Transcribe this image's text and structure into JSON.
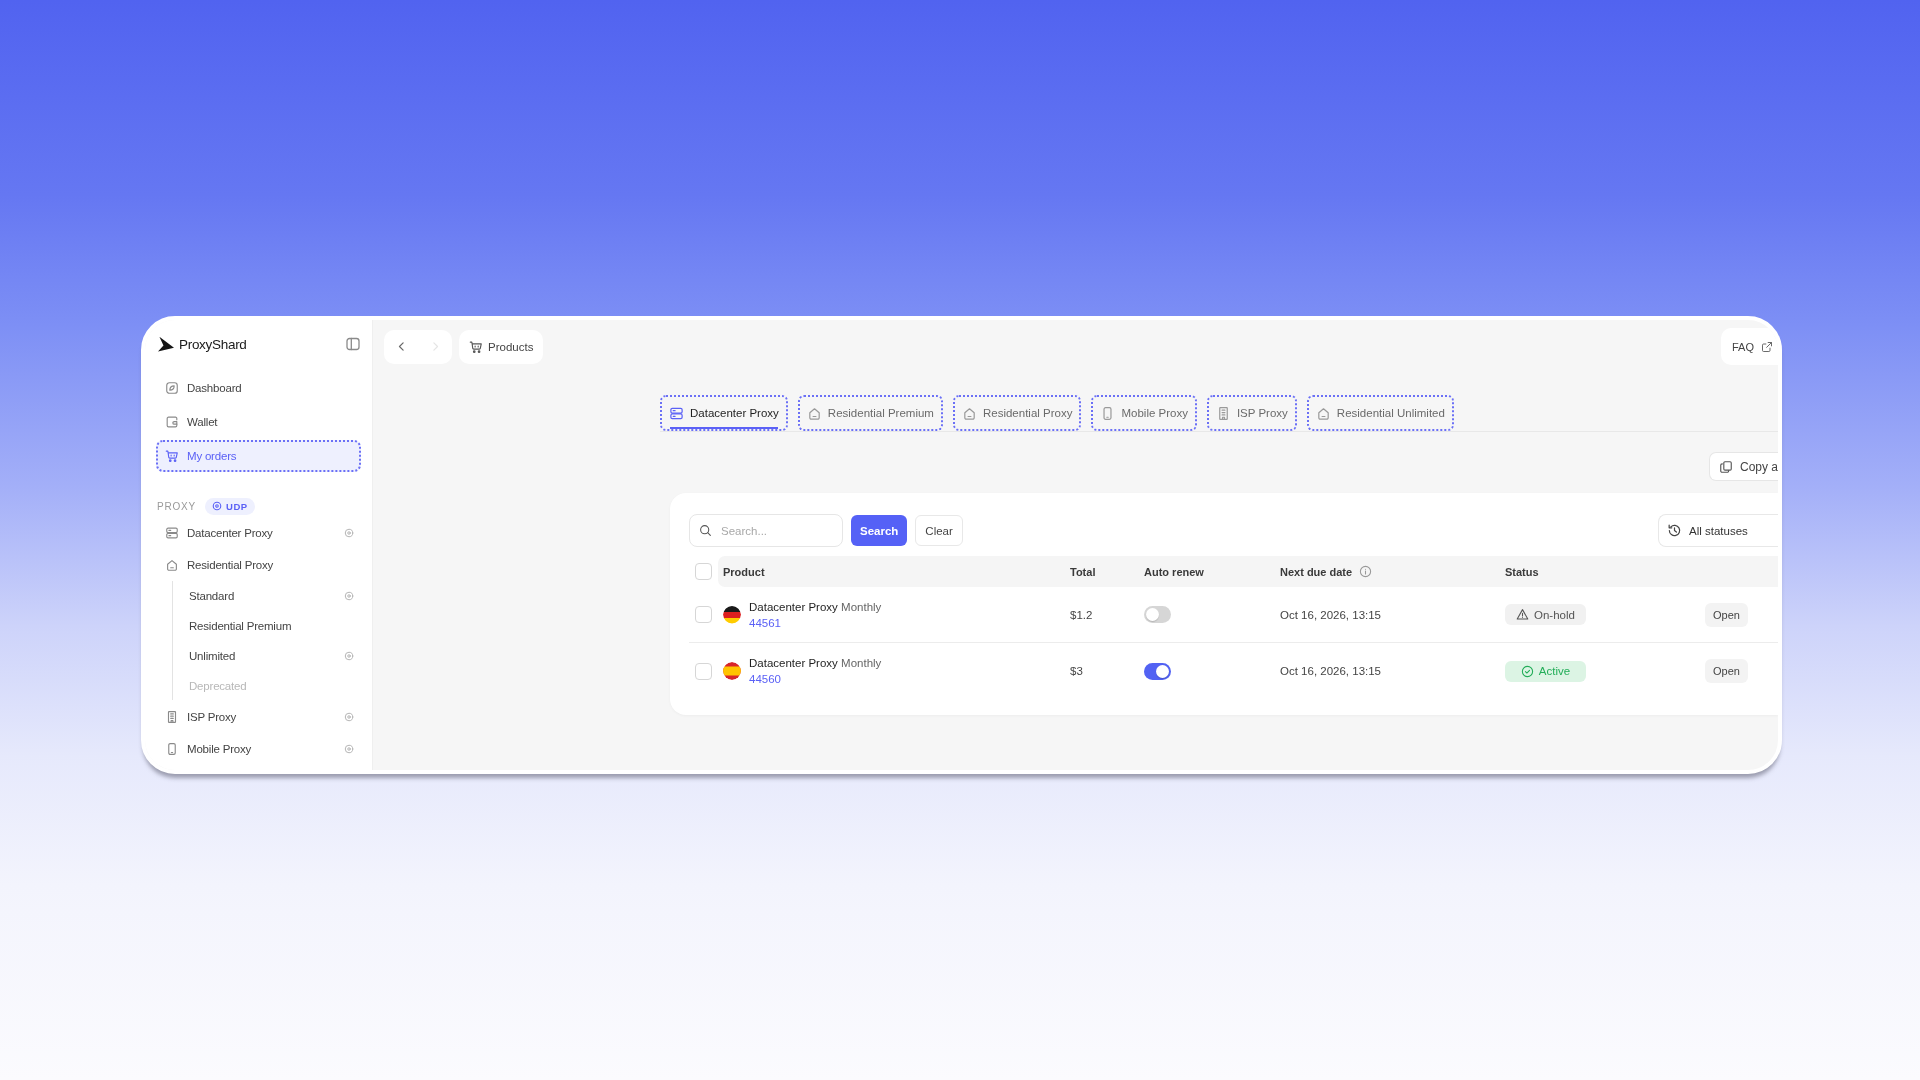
{
  "sidebar": {
    "brand": "ProxyShard",
    "nav": [
      {
        "label": "Dashboard",
        "selected": false
      },
      {
        "label": "Wallet",
        "selected": false
      },
      {
        "label": "My orders",
        "selected": true
      }
    ],
    "section_label": "PROXY",
    "section_badge": "UDP",
    "products": [
      {
        "label": "Datacenter Proxy",
        "kind": "datacenter",
        "udp": true
      },
      {
        "label": "Residential Proxy",
        "kind": "residential",
        "udp": false,
        "children": [
          {
            "label": "Standard",
            "udp": true,
            "disabled": false
          },
          {
            "label": "Residential Premium",
            "udp": false,
            "disabled": false
          },
          {
            "label": "Unlimited",
            "udp": true,
            "disabled": false
          },
          {
            "label": "Deprecated",
            "udp": false,
            "disabled": true
          }
        ]
      },
      {
        "label": "ISP Proxy",
        "kind": "isp",
        "udp": true
      },
      {
        "label": "Mobile Proxy",
        "kind": "mobile",
        "udp": true
      }
    ]
  },
  "topbar": {
    "nav_buttons": [
      {
        "disabled": false
      },
      {
        "disabled": true
      }
    ],
    "breadcrumb": "Products",
    "faq": "FAQ"
  },
  "tabs": [
    {
      "label": "Datacenter Proxy",
      "kind": "datacenter",
      "selected": true
    },
    {
      "label": "Residential Premium",
      "kind": "residential",
      "selected": false
    },
    {
      "label": "Residential Proxy",
      "kind": "residential",
      "selected": false
    },
    {
      "label": "Mobile Proxy",
      "kind": "mobile",
      "selected": false
    },
    {
      "label": "ISP Proxy",
      "kind": "isp",
      "selected": false
    },
    {
      "label": "Residential Unlimited",
      "kind": "residential",
      "selected": false
    }
  ],
  "copy_button": "Copy a",
  "orders": {
    "search": {
      "placeholder": "Search..."
    },
    "search_button": "Search",
    "clear_button": "Clear",
    "status_filter": "All statuses",
    "select_all": {
      "checked": false
    },
    "columns": [
      {
        "label": "Product",
        "info": false
      },
      {
        "label": "Total",
        "info": false
      },
      {
        "label": "Auto renew",
        "info": false
      },
      {
        "label": "Next due date",
        "info": true
      },
      {
        "label": "Status",
        "info": false
      }
    ],
    "rows": [
      {
        "checked": false,
        "flag": {
          "kind": "germany"
        },
        "product": "Datacenter Proxy",
        "period": "Monthly",
        "order_id": "44561",
        "total": "$1.2",
        "auto_renew": false,
        "next_due": "Oct 16, 2026, 13:15",
        "status": {
          "label": "On-hold",
          "kind": "on_hold"
        },
        "action": "Open"
      },
      {
        "checked": false,
        "flag": {
          "kind": "spain"
        },
        "product": "Datacenter Proxy",
        "period": "Monthly",
        "order_id": "44560",
        "total": "$3",
        "auto_renew": true,
        "next_due": "Oct 16, 2026, 13:15",
        "status": {
          "label": "Active",
          "kind": "active"
        },
        "action": "Open"
      }
    ]
  }
}
